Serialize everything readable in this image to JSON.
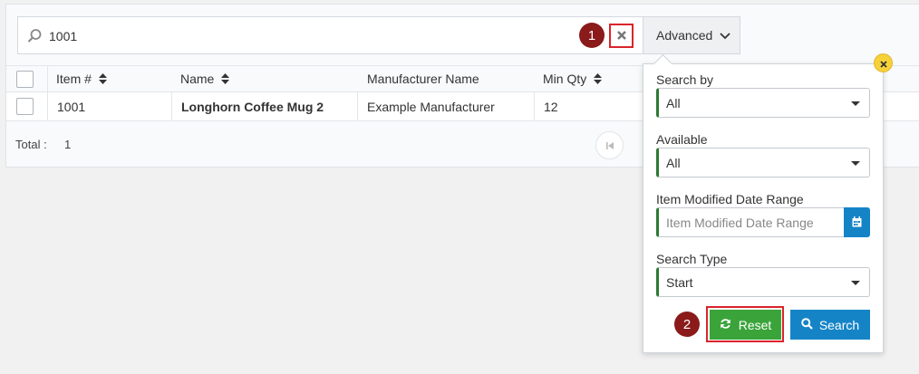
{
  "search": {
    "value": "1001",
    "advanced_label": "Advanced"
  },
  "callouts": {
    "first": "1",
    "second": "2"
  },
  "table": {
    "headers": {
      "item": "Item #",
      "name": "Name",
      "manufacturer": "Manufacturer Name",
      "min_qty": "Min Qty"
    },
    "rows": [
      {
        "item": "1001",
        "name": "Longhorn Coffee Mug 2",
        "manufacturer": "Example Manufacturer",
        "min_qty": "12"
      }
    ]
  },
  "footer": {
    "total_label": "Total :",
    "total_value": "1"
  },
  "advanced": {
    "search_by": {
      "label": "Search by",
      "value": "All"
    },
    "available": {
      "label": "Available",
      "value": "All"
    },
    "date_range": {
      "label": "Item Modified Date Range",
      "placeholder": "Item Modified Date Range"
    },
    "search_type": {
      "label": "Search Type",
      "value": "Start"
    },
    "reset_label": "Reset",
    "search_label": "Search"
  },
  "colors": {
    "primary": "#1584c7",
    "success": "#3aa43a",
    "callout": "#8b1a1a",
    "highlight": "#d9252b",
    "accent_border": "#2d7a35"
  }
}
